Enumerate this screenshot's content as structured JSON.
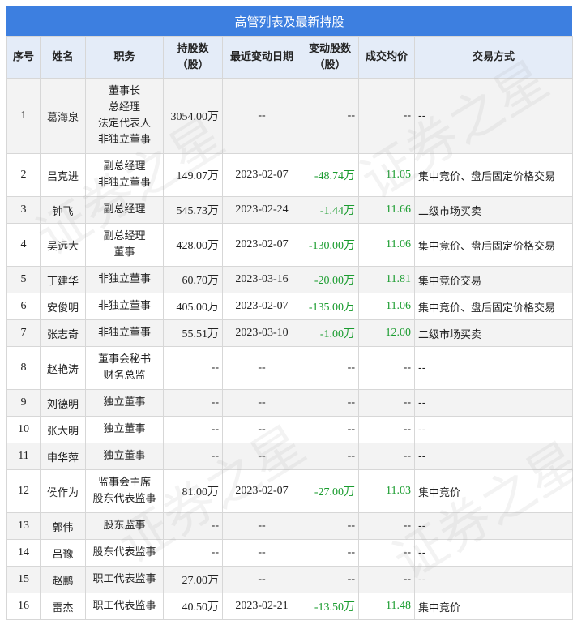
{
  "title": "高管列表及最新持股",
  "watermark": "证券之星",
  "colors": {
    "header_bg": "#3d7fe0",
    "column_header_bg": "#e4ecf8",
    "increase_text": "#1a9c2f"
  },
  "columns": [
    {
      "label": "序号"
    },
    {
      "label": "姓名"
    },
    {
      "label": "职务"
    },
    {
      "label": "持股数（股）"
    },
    {
      "label": "最近变动日期"
    },
    {
      "label": "变动股数（股）"
    },
    {
      "label": "成交均价"
    },
    {
      "label": "交易方式"
    }
  ],
  "rows": [
    {
      "no": "1",
      "name": "葛海泉",
      "roles": [
        "董事长",
        "总经理",
        "法定代表人",
        "非独立董事"
      ],
      "shares": "3054.00万",
      "date": "--",
      "change": "--",
      "price": "--",
      "method": "--"
    },
    {
      "no": "2",
      "name": "吕克进",
      "roles": [
        "副总经理",
        "非独立董事"
      ],
      "shares": "149.07万",
      "date": "2023-02-07",
      "change": "-48.74万",
      "price": "11.05",
      "method": "集中竞价、盘后固定价格交易"
    },
    {
      "no": "3",
      "name": "钟飞",
      "roles": [
        "副总经理"
      ],
      "shares": "545.73万",
      "date": "2023-02-24",
      "change": "-1.44万",
      "price": "11.66",
      "method": "二级市场买卖"
    },
    {
      "no": "4",
      "name": "吴远大",
      "roles": [
        "副总经理",
        "董事"
      ],
      "shares": "428.00万",
      "date": "2023-02-07",
      "change": "-130.00万",
      "price": "11.06",
      "method": "集中竞价、盘后固定价格交易"
    },
    {
      "no": "5",
      "name": "丁建华",
      "roles": [
        "非独立董事"
      ],
      "shares": "60.70万",
      "date": "2023-03-16",
      "change": "-20.00万",
      "price": "11.81",
      "method": "集中竞价交易"
    },
    {
      "no": "6",
      "name": "安俊明",
      "roles": [
        "非独立董事"
      ],
      "shares": "405.00万",
      "date": "2023-02-07",
      "change": "-135.00万",
      "price": "11.06",
      "method": "集中竞价、盘后固定价格交易"
    },
    {
      "no": "7",
      "name": "张志奇",
      "roles": [
        "非独立董事"
      ],
      "shares": "55.51万",
      "date": "2023-03-10",
      "change": "-1.00万",
      "price": "12.00",
      "method": "二级市场买卖"
    },
    {
      "no": "8",
      "name": "赵艳涛",
      "roles": [
        "董事会秘书",
        "财务总监"
      ],
      "shares": "--",
      "date": "--",
      "change": "--",
      "price": "--",
      "method": "--"
    },
    {
      "no": "9",
      "name": "刘德明",
      "roles": [
        "独立董事"
      ],
      "shares": "--",
      "date": "--",
      "change": "--",
      "price": "--",
      "method": "--"
    },
    {
      "no": "10",
      "name": "张大明",
      "roles": [
        "独立董事"
      ],
      "shares": "--",
      "date": "--",
      "change": "--",
      "price": "--",
      "method": "--"
    },
    {
      "no": "11",
      "name": "申华萍",
      "roles": [
        "独立董事"
      ],
      "shares": "--",
      "date": "--",
      "change": "--",
      "price": "--",
      "method": "--"
    },
    {
      "no": "12",
      "name": "侯作为",
      "roles": [
        "监事会主席",
        "股东代表监事"
      ],
      "shares": "81.00万",
      "date": "2023-02-07",
      "change": "-27.00万",
      "price": "11.03",
      "method": "集中竞价"
    },
    {
      "no": "13",
      "name": "郭伟",
      "roles": [
        "股东监事"
      ],
      "shares": "--",
      "date": "--",
      "change": "--",
      "price": "--",
      "method": "--"
    },
    {
      "no": "14",
      "name": "吕豫",
      "roles": [
        "股东代表监事"
      ],
      "shares": "--",
      "date": "--",
      "change": "--",
      "price": "--",
      "method": "--"
    },
    {
      "no": "15",
      "name": "赵鹏",
      "roles": [
        "职工代表监事"
      ],
      "shares": "27.00万",
      "date": "--",
      "change": "--",
      "price": "--",
      "method": "--"
    },
    {
      "no": "16",
      "name": "雷杰",
      "roles": [
        "职工代表监事"
      ],
      "shares": "40.50万",
      "date": "2023-02-21",
      "change": "-13.50万",
      "price": "11.48",
      "method": "集中竞价"
    }
  ]
}
